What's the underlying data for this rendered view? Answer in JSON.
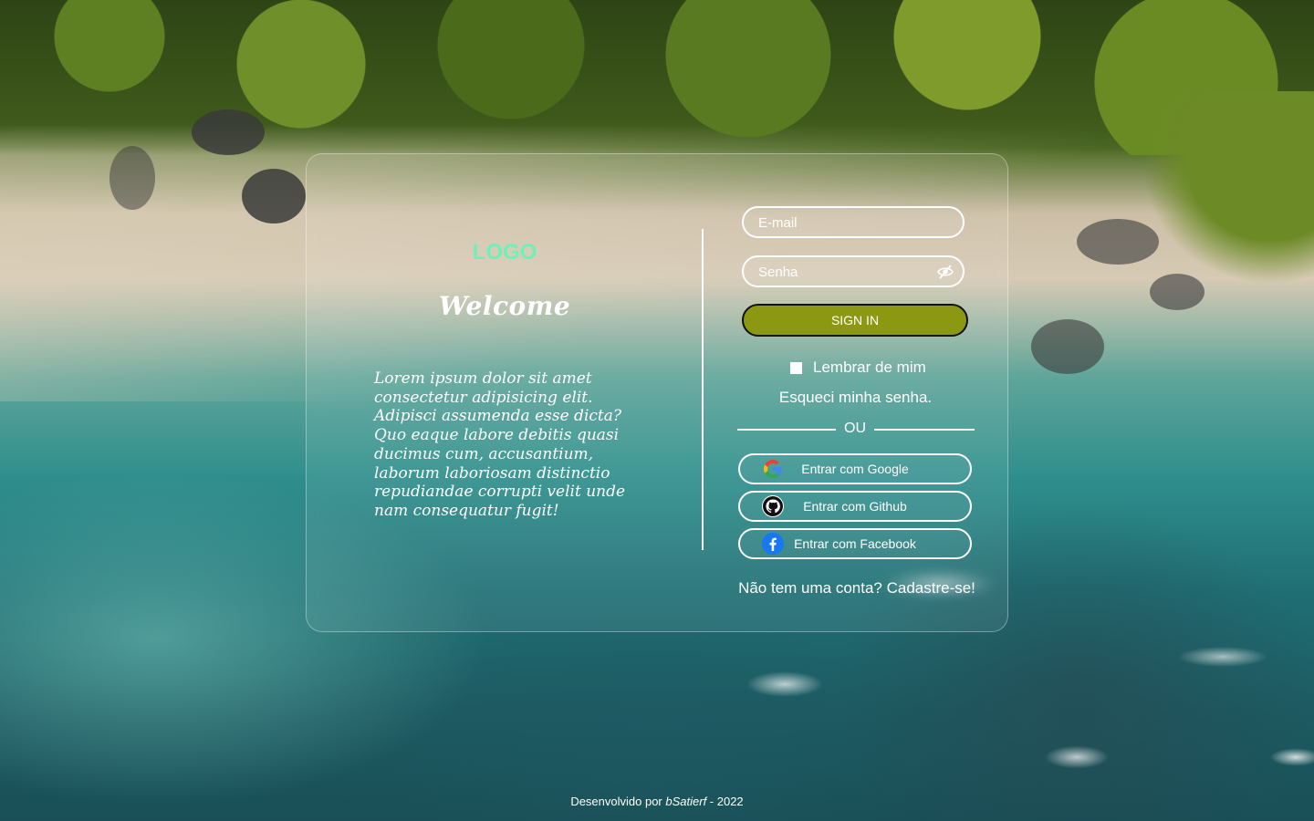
{
  "background": {
    "description_colors": [
      "#3d5a1c",
      "#d6cab4",
      "#2f8f8d",
      "#1d5b62"
    ]
  },
  "brand": {
    "logo": "LOGO",
    "logo_color": "#6ef0b8",
    "welcome": "Welcome"
  },
  "intro_text": "Lorem ipsum dolor sit amet consectetur adipisicing elit. Adipisci assumenda esse dicta? Quo eaque labore debitis quasi ducimus cum, accusantium, laborum laboriosam distinctio repudiandae corrupti velit unde nam consequatur fugit!",
  "form": {
    "email_placeholder": "E-mail",
    "password_placeholder": "Senha",
    "password_toggle_icon": "eye-slash-icon",
    "signin_label": "SIGN IN",
    "signin_color": "#8d9812",
    "remember_label": "Lembrar de mim",
    "remember_checked": false,
    "forgot_label": "Esqueci minha senha.",
    "or_label": "OU"
  },
  "social": {
    "google_label": "Entrar com Google",
    "github_label": "Entrar com Github",
    "facebook_label": "Entrar com Facebook",
    "google_icon": "google-icon",
    "github_icon": "github-icon",
    "facebook_icon": "facebook-icon",
    "facebook_color": "#1877f2"
  },
  "signup_label": "Não tem uma conta? Cadastre-se!",
  "footer": {
    "prefix": "Desenvolvido por ",
    "author": "bSatierf",
    "suffix": " - 2022"
  }
}
